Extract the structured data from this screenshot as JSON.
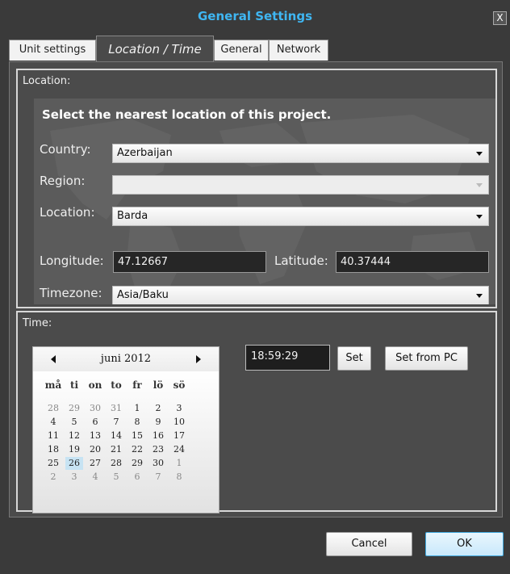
{
  "window": {
    "title": "General Settings",
    "close_glyph": "X"
  },
  "tabs": [
    {
      "label": "Unit settings"
    },
    {
      "label": "Location / Time"
    },
    {
      "label": "General"
    },
    {
      "label": "Network"
    }
  ],
  "location": {
    "group_label": "Location:",
    "heading": "Select the nearest location of this project.",
    "country_label": "Country:",
    "country_value": "Azerbaijan",
    "region_label": "Region:",
    "region_value": "",
    "location_label": "Location:",
    "location_value": "Barda",
    "longitude_label": "Longitude:",
    "longitude_value": "47.12667",
    "latitude_label": "Latitude:",
    "latitude_value": "40.37444",
    "timezone_label": "Timezone:",
    "timezone_value": "Asia/Baku"
  },
  "time": {
    "group_label": "Time:",
    "time_value": "18:59:29",
    "set_label": "Set",
    "set_from_pc_label": "Set from PC"
  },
  "calendar": {
    "month_label": "juni 2012",
    "weekdays": [
      "må",
      "ti",
      "on",
      "to",
      "fr",
      "lö",
      "sö"
    ],
    "weeks": [
      [
        {
          "d": "28",
          "o": true
        },
        {
          "d": "29",
          "o": true
        },
        {
          "d": "30",
          "o": true
        },
        {
          "d": "31",
          "o": true
        },
        {
          "d": "1"
        },
        {
          "d": "2"
        },
        {
          "d": "3"
        }
      ],
      [
        {
          "d": "4"
        },
        {
          "d": "5"
        },
        {
          "d": "6"
        },
        {
          "d": "7"
        },
        {
          "d": "8"
        },
        {
          "d": "9"
        },
        {
          "d": "10"
        }
      ],
      [
        {
          "d": "11"
        },
        {
          "d": "12"
        },
        {
          "d": "13"
        },
        {
          "d": "14"
        },
        {
          "d": "15"
        },
        {
          "d": "16"
        },
        {
          "d": "17"
        }
      ],
      [
        {
          "d": "18"
        },
        {
          "d": "19"
        },
        {
          "d": "20"
        },
        {
          "d": "21"
        },
        {
          "d": "22"
        },
        {
          "d": "23"
        },
        {
          "d": "24"
        }
      ],
      [
        {
          "d": "25"
        },
        {
          "d": "26",
          "s": true
        },
        {
          "d": "27"
        },
        {
          "d": "28"
        },
        {
          "d": "29"
        },
        {
          "d": "30"
        },
        {
          "d": "1",
          "o": true
        }
      ],
      [
        {
          "d": "2",
          "o": true
        },
        {
          "d": "3",
          "o": true
        },
        {
          "d": "4",
          "o": true
        },
        {
          "d": "5",
          "o": true
        },
        {
          "d": "6",
          "o": true
        },
        {
          "d": "7",
          "o": true
        },
        {
          "d": "8",
          "o": true
        }
      ]
    ]
  },
  "footer": {
    "cancel_label": "Cancel",
    "ok_label": "OK"
  },
  "colors": {
    "title": "#3fb6f2",
    "background": "#3a3a3a",
    "panel": "#4b4b4b",
    "selected_day": "#c7e3f3",
    "ok_border": "#3fa7dc"
  }
}
